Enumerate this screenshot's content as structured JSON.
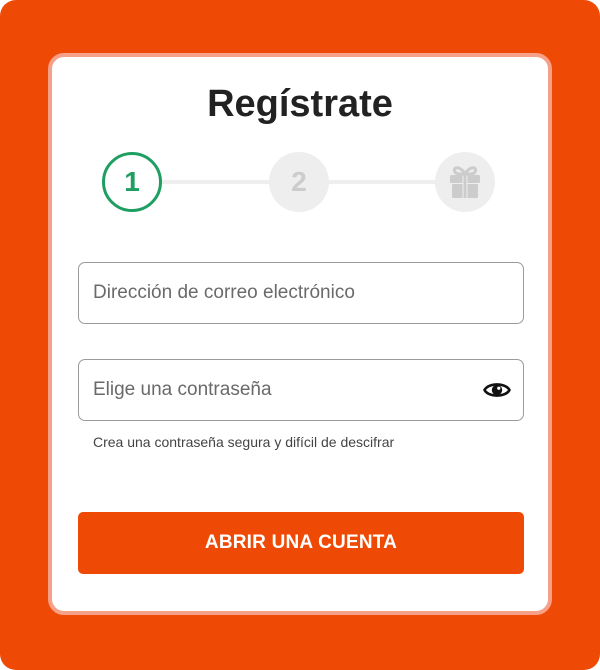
{
  "colors": {
    "background": "#ef4a05",
    "card": "#ffffff",
    "card_border": "#f7a089",
    "active_step": "#1f9e62",
    "inactive_step": "#eeeeee",
    "inactive_step_text": "#cccccc",
    "primary_button": "#ef4a05"
  },
  "header": {
    "title": "Regístrate"
  },
  "stepper": {
    "steps": [
      {
        "label": "1",
        "state": "active"
      },
      {
        "label": "2",
        "state": "inactive"
      },
      {
        "icon": "gift-icon",
        "state": "inactive"
      }
    ]
  },
  "form": {
    "email": {
      "placeholder": "Dirección de correo electrónico",
      "value": ""
    },
    "password": {
      "placeholder": "Elige una contraseña",
      "value": "",
      "toggle_icon": "eye-icon"
    },
    "password_hint": "Crea una contraseña segura y difícil de descifrar",
    "submit_label": "ABRIR UNA CUENTA"
  }
}
